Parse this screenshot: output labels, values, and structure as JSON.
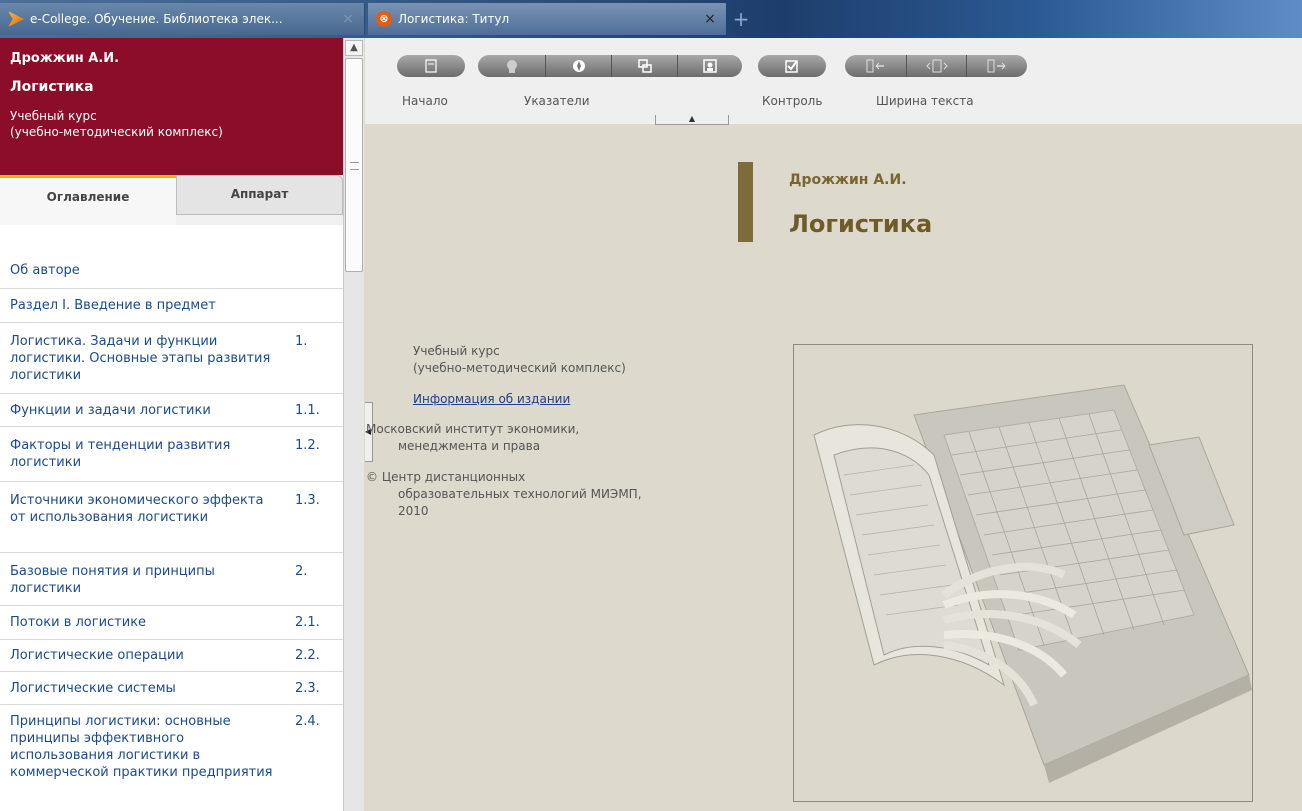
{
  "browser": {
    "tabs": [
      {
        "label": "e-College. Обучение. Библиотека элек...",
        "close": "×"
      },
      {
        "label": "Логистика: Титул",
        "close": "×"
      }
    ],
    "new_tab": "+"
  },
  "sidebar": {
    "author": "Дрожжин А.И.",
    "title": "Логистика",
    "subtitle_line1": "Учебный курс",
    "subtitle_line2": "(учебно-методический комплекс)",
    "tabs": {
      "toc": "Оглавление",
      "apparatus": "Аппарат"
    },
    "toc": [
      {
        "title": "Об авторе",
        "num": ""
      },
      {
        "title": "Раздел I. Введение в предмет",
        "num": ""
      },
      {
        "title": "Логистика. Задачи и функции логистики. Основные этапы развития логистики",
        "num": "1."
      },
      {
        "title": "Функции и задачи логистики",
        "num": "1.1."
      },
      {
        "title": "Факторы и тенденции развития логистики",
        "num": "1.2."
      },
      {
        "title": "Источники экономического эффекта от использования логистики",
        "num": "1.3."
      },
      {
        "title": "Базовые понятия и принципы логистики",
        "num": "2."
      },
      {
        "title": "Потоки в логистике",
        "num": "2.1."
      },
      {
        "title": "Логистические операции",
        "num": "2.2."
      },
      {
        "title": "Логистические системы",
        "num": "2.3."
      },
      {
        "title": "Принципы логистики: основные принципы эффективного использования логистики в коммерческой практики предприятия",
        "num": "2.4."
      }
    ]
  },
  "toolbar": {
    "labels": {
      "start": "Начало",
      "pointers": "Указатели",
      "control": "Контроль",
      "text_width": "Ширина текста"
    }
  },
  "content": {
    "author": "Дрожжин А.И.",
    "title": "Логистика",
    "course_line1": "Учебный курс",
    "course_line2": "(учебно-методический комплекс)",
    "edition_link": "Информация об издании",
    "institute_line1": "Московский институт экономики,",
    "institute_line2": "менеджмента и права",
    "copyright_line1": "© Центр дистанционных",
    "copyright_line2": "образовательных технологий МИЭМП,",
    "copyright_line3": "2010"
  },
  "colors": {
    "sidebar_header": "#8b0d2a",
    "accent_bar": "#7d6b39",
    "tab_indicator": "#f0b400",
    "link": "#1b4b8e"
  }
}
